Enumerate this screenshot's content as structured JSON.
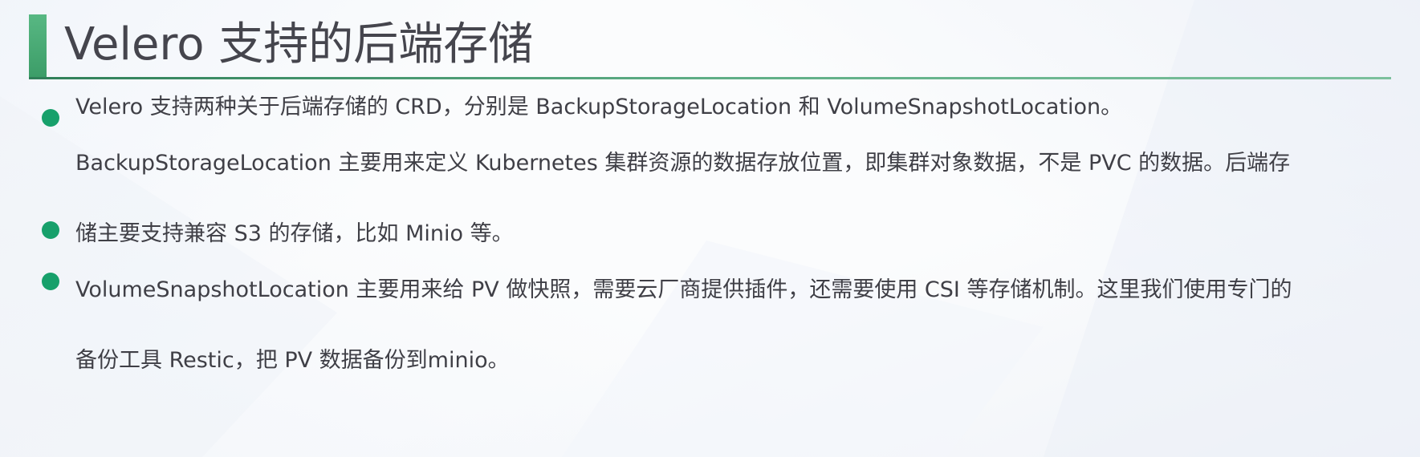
{
  "slide": {
    "title": "Velero 支持的后端存储",
    "accent_color": "#4aa874",
    "bullet_color": "#17a06b",
    "bullets": [
      {
        "lines": [
          "Velero 支持两种关于后端存储的 CRD，分别是 BackupStorageLocation 和 VolumeSnapshotLocation。"
        ]
      },
      {
        "lines": [
          "BackupStorageLocation 主要用来定义 Kubernetes 集群资源的数据存放位置，即集群对象数据，不是 PVC 的数据。后端存",
          "储主要支持兼容 S3 的存储，比如 Minio 等。"
        ]
      },
      {
        "lines": [
          "VolumeSnapshotLocation 主要用来给 PV 做快照，需要云厂商提供插件，还需要使用 CSI 等存储机制。这里我们使用专门的",
          "备份工具 Restic，把 PV 数据备份到minio。"
        ]
      }
    ]
  }
}
